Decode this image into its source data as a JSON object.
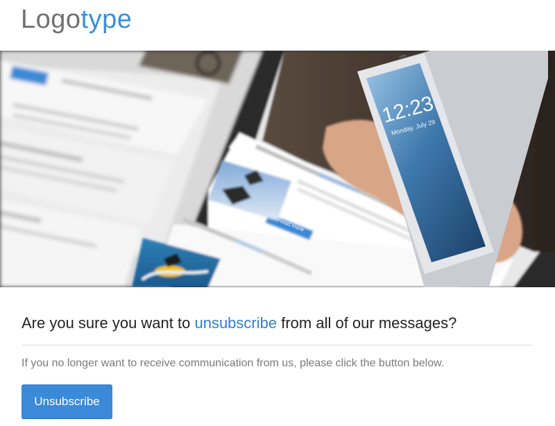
{
  "header": {
    "logo_part1": "Logo",
    "logo_part2": "type"
  },
  "hero": {
    "image_label": "Blurred photo of a tablet showing an email template and a hand holding a smartphone",
    "phone_time": "12:23",
    "phone_date": "Monday, July 29",
    "button_label": "Read more"
  },
  "main": {
    "headline_before": "Are you sure you want to ",
    "headline_link": "unsubscribe",
    "headline_after": " from all of our messages?",
    "subtext": "If you no longer want to receive communication from us, please click the button below.",
    "unsubscribe_label": "Unsubscribe"
  },
  "colors": {
    "accent": "#3a8ad9",
    "link": "#2f80d1",
    "logo_gray": "#707070",
    "logo_blue": "#3a8fd8",
    "text_dark": "#222222",
    "text_muted": "#7a7a7a"
  }
}
